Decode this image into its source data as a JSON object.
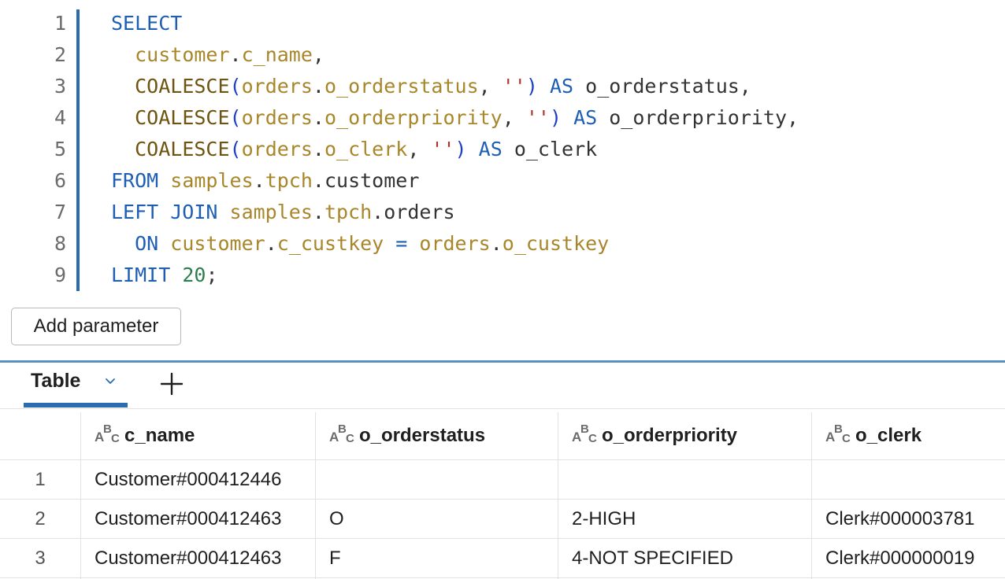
{
  "editor": {
    "line_numbers": [
      "1",
      "2",
      "3",
      "4",
      "5",
      "6",
      "7",
      "8",
      "9"
    ],
    "lines": [
      [
        {
          "t": "SELECT",
          "c": "k"
        }
      ],
      [
        {
          "t": "  "
        },
        {
          "t": "customer",
          "c": "id"
        },
        {
          "t": ".",
          "c": "o"
        },
        {
          "t": "c_name",
          "c": "id"
        },
        {
          "t": ",",
          "c": "o"
        }
      ],
      [
        {
          "t": "  "
        },
        {
          "t": "COALESCE",
          "c": "f"
        },
        {
          "t": "(",
          "c": "p"
        },
        {
          "t": "orders",
          "c": "id"
        },
        {
          "t": ".",
          "c": "o"
        },
        {
          "t": "o_orderstatus",
          "c": "id"
        },
        {
          "t": ", ",
          "c": "o"
        },
        {
          "t": "''",
          "c": "s"
        },
        {
          "t": ")",
          "c": "p"
        },
        {
          "t": " "
        },
        {
          "t": "AS",
          "c": "k"
        },
        {
          "t": " o_orderstatus,",
          "c": "o"
        }
      ],
      [
        {
          "t": "  "
        },
        {
          "t": "COALESCE",
          "c": "f"
        },
        {
          "t": "(",
          "c": "p"
        },
        {
          "t": "orders",
          "c": "id"
        },
        {
          "t": ".",
          "c": "o"
        },
        {
          "t": "o_orderpriority",
          "c": "id"
        },
        {
          "t": ", ",
          "c": "o"
        },
        {
          "t": "''",
          "c": "s"
        },
        {
          "t": ")",
          "c": "p"
        },
        {
          "t": " "
        },
        {
          "t": "AS",
          "c": "k"
        },
        {
          "t": " o_orderpriority,",
          "c": "o"
        }
      ],
      [
        {
          "t": "  "
        },
        {
          "t": "COALESCE",
          "c": "f"
        },
        {
          "t": "(",
          "c": "p"
        },
        {
          "t": "orders",
          "c": "id"
        },
        {
          "t": ".",
          "c": "o"
        },
        {
          "t": "o_clerk",
          "c": "id"
        },
        {
          "t": ", ",
          "c": "o"
        },
        {
          "t": "''",
          "c": "s"
        },
        {
          "t": ")",
          "c": "p"
        },
        {
          "t": " "
        },
        {
          "t": "AS",
          "c": "k"
        },
        {
          "t": " o_clerk",
          "c": "o"
        }
      ],
      [
        {
          "t": "FROM",
          "c": "k"
        },
        {
          "t": " "
        },
        {
          "t": "samples",
          "c": "id"
        },
        {
          "t": ".",
          "c": "o"
        },
        {
          "t": "tpch",
          "c": "id"
        },
        {
          "t": ".customer",
          "c": "o"
        }
      ],
      [
        {
          "t": "LEFT JOIN",
          "c": "k"
        },
        {
          "t": " "
        },
        {
          "t": "samples",
          "c": "id"
        },
        {
          "t": ".",
          "c": "o"
        },
        {
          "t": "tpch",
          "c": "id"
        },
        {
          "t": ".orders",
          "c": "o"
        }
      ],
      [
        {
          "t": "  "
        },
        {
          "t": "ON",
          "c": "k"
        },
        {
          "t": " "
        },
        {
          "t": "customer",
          "c": "id"
        },
        {
          "t": ".",
          "c": "o"
        },
        {
          "t": "c_custkey",
          "c": "id"
        },
        {
          "t": " = ",
          "c": "k"
        },
        {
          "t": "orders",
          "c": "id"
        },
        {
          "t": ".",
          "c": "o"
        },
        {
          "t": "o_custkey",
          "c": "id"
        }
      ],
      [
        {
          "t": "LIMIT",
          "c": "k"
        },
        {
          "t": " "
        },
        {
          "t": "20",
          "c": "n"
        },
        {
          "t": ";",
          "c": "o"
        }
      ]
    ]
  },
  "add_parameter_label": "Add parameter",
  "results": {
    "tab_label": "Table",
    "add_icon": "plus-icon",
    "type_icon": "string-type-icon",
    "columns": [
      "c_name",
      "o_orderstatus",
      "o_orderpriority",
      "o_clerk"
    ],
    "rows": [
      {
        "index": "1",
        "cells": [
          "Customer#000412446",
          "",
          "",
          ""
        ]
      },
      {
        "index": "2",
        "cells": [
          "Customer#000412463",
          "O",
          "2-HIGH",
          "Clerk#000003781"
        ]
      },
      {
        "index": "3",
        "cells": [
          "Customer#000412463",
          "F",
          "4-NOT SPECIFIED",
          "Clerk#000000019"
        ]
      }
    ]
  },
  "colors": {
    "accent": "#2b6cb0",
    "keyword": "#1e5fb3",
    "identifier": "#a8862a",
    "string": "#b0302a",
    "number": "#2e7d4f"
  }
}
